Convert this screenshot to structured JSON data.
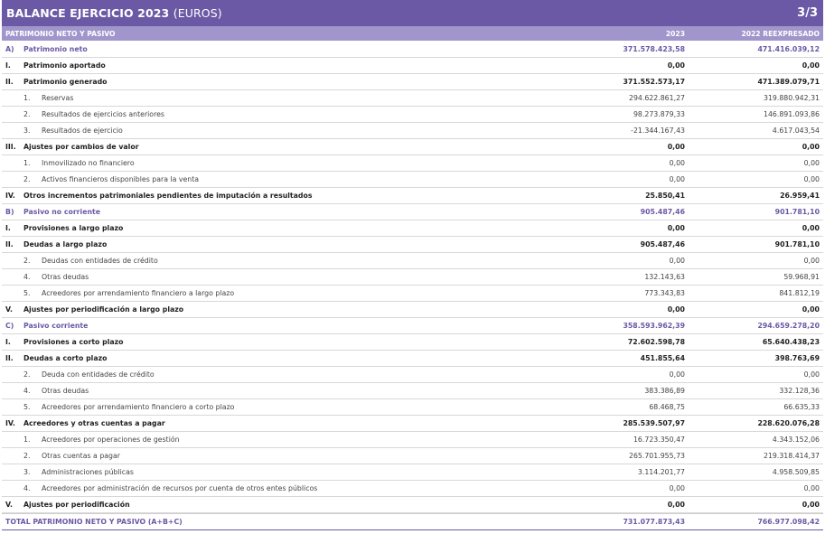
{
  "header": {
    "title": "BALANCE EJERCICIO 2023",
    "title_suffix": "(EUROS)",
    "page": "3/3"
  },
  "columns": {
    "label": "PATRIMONIO NETO Y PASIVO",
    "col_a": "2023",
    "col_b": "2022 REEXPRESADO"
  },
  "rows": [
    {
      "level": "l0",
      "num": "A)",
      "label": "Patrimonio neto",
      "a": "371.578.423,58",
      "b": "471.416.039,12"
    },
    {
      "level": "l1",
      "num": "I.",
      "label": "Patrimonio aportado",
      "a": "0,00",
      "b": "0,00"
    },
    {
      "level": "l1",
      "num": "II.",
      "label": "Patrimonio generado",
      "a": "371.552.573,17",
      "b": "471.389.079,71"
    },
    {
      "level": "l2",
      "num": "1.",
      "label": "Reservas",
      "a": "294.622.861,27",
      "b": "319.880.942,31"
    },
    {
      "level": "l2",
      "num": "2.",
      "label": "Resultados de ejercicios anteriores",
      "a": "98.273.879,33",
      "b": "146.891.093,86"
    },
    {
      "level": "l2",
      "num": "3.",
      "label": "Resultados de ejercicio",
      "a": "-21.344.167,43",
      "b": "4.617.043,54"
    },
    {
      "level": "l1",
      "num": "III.",
      "label": "Ajustes por cambios de valor",
      "a": "0,00",
      "b": "0,00"
    },
    {
      "level": "l2",
      "num": "1.",
      "label": "Inmovilizado no financiero",
      "a": "0,00",
      "b": "0,00"
    },
    {
      "level": "l2",
      "num": "2.",
      "label": "Activos financieros disponibles para la venta",
      "a": "0,00",
      "b": "0,00"
    },
    {
      "level": "l1",
      "num": "IV.",
      "label": "Otros incrementos patrimoniales pendientes de imputación a resultados",
      "a": "25.850,41",
      "b": "26.959,41"
    },
    {
      "level": "l0",
      "num": "B)",
      "label": "Pasivo no corriente",
      "a": "905.487,46",
      "b": "901.781,10"
    },
    {
      "level": "l1",
      "num": "I.",
      "label": "Provisiones a largo plazo",
      "a": "0,00",
      "b": "0,00"
    },
    {
      "level": "l1",
      "num": "II.",
      "label": "Deudas a largo plazo",
      "a": "905.487,46",
      "b": "901.781,10"
    },
    {
      "level": "l2",
      "num": "2.",
      "label": "Deudas con entidades de crédito",
      "a": "0,00",
      "b": "0,00"
    },
    {
      "level": "l2",
      "num": "4.",
      "label": "Otras deudas",
      "a": "132.143,63",
      "b": "59.968,91"
    },
    {
      "level": "l2",
      "num": "5.",
      "label": "Acreedores por arrendamiento financiero a largo plazo",
      "a": "773.343,83",
      "b": "841.812,19"
    },
    {
      "level": "l1",
      "num": "V.",
      "label": "Ajustes por periodificación a largo plazo",
      "a": "0,00",
      "b": "0,00"
    },
    {
      "level": "l0",
      "num": "C)",
      "label": "Pasivo corriente",
      "a": "358.593.962,39",
      "b": "294.659.278,20"
    },
    {
      "level": "l1",
      "num": "I.",
      "label": "Provisiones a corto plazo",
      "a": "72.602.598,78",
      "b": "65.640.438,23"
    },
    {
      "level": "l1",
      "num": "II.",
      "label": "Deudas a corto plazo",
      "a": "451.855,64",
      "b": "398.763,69"
    },
    {
      "level": "l2",
      "num": "2.",
      "label": "Deuda con entidades de crédito",
      "a": "0,00",
      "b": "0,00"
    },
    {
      "level": "l2",
      "num": "4.",
      "label": "Otras deudas",
      "a": "383.386,89",
      "b": "332.128,36"
    },
    {
      "level": "l2",
      "num": "5.",
      "label": "Acreedores por arrendamiento financiero a corto plazo",
      "a": "68.468,75",
      "b": "66.635,33"
    },
    {
      "level": "l1",
      "num": "IV.",
      "label": "Acreedores y otras cuentas a pagar",
      "a": "285.539.507,97",
      "b": "228.620.076,28"
    },
    {
      "level": "l2",
      "num": "1.",
      "label": "Acreedores por operaciones de gestión",
      "a": "16.723.350,47",
      "b": "4.343.152,06"
    },
    {
      "level": "l2",
      "num": "2.",
      "label": "Otras cuentas a pagar",
      "a": "265.701.955,73",
      "b": "219.318.414,37"
    },
    {
      "level": "l2",
      "num": "3.",
      "label": "Administraciones públicas",
      "a": "3.114.201,77",
      "b": "4.958.509,85"
    },
    {
      "level": "l2",
      "num": "4.",
      "label": "Acreedores por administración de recursos por cuenta de otros entes públicos",
      "a": "0,00",
      "b": "0,00"
    },
    {
      "level": "l1",
      "num": "V.",
      "label": "Ajustes por periodificación",
      "a": "0,00",
      "b": "0,00"
    }
  ],
  "total": {
    "label": "TOTAL PATRIMONIO NETO Y PASIVO (A+B+C)",
    "a": "731.077.873,43",
    "b": "766.977.098,42"
  }
}
